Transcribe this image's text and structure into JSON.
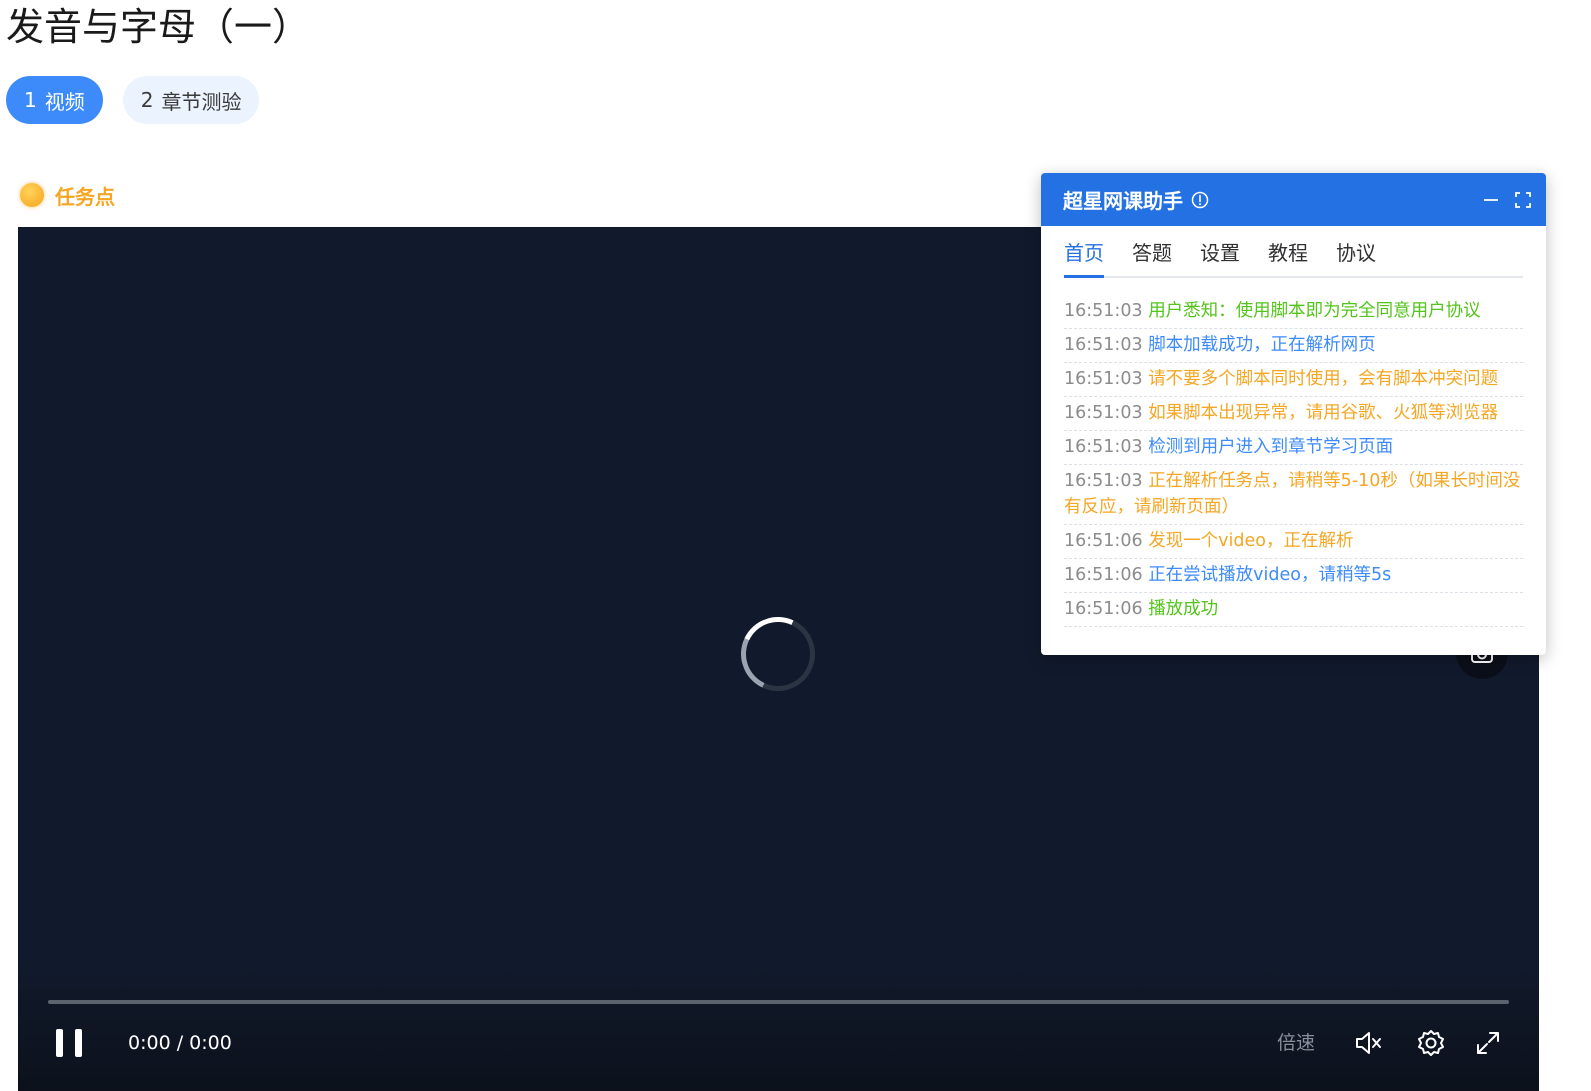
{
  "page": {
    "title": "发音与字母（一）"
  },
  "steps": [
    {
      "index": "1",
      "label": "视频",
      "active": true
    },
    {
      "index": "2",
      "label": "章节测验",
      "active": false
    }
  ],
  "task": {
    "label": "任务点"
  },
  "player": {
    "time": "0:00 / 0:00",
    "speed_label": "倍速",
    "progress": 0,
    "icons": {
      "pause": "pause-icon",
      "mute": "volume-muted-icon",
      "settings": "gear-icon",
      "fullscreen": "expand-icon",
      "screenshot": "camera-icon",
      "loading": "spinner-icon"
    }
  },
  "helper": {
    "title": "超星网课助手",
    "tabs": [
      "首页",
      "答题",
      "设置",
      "教程",
      "协议"
    ],
    "active_tab": "首页",
    "logs": [
      {
        "time": "16:51:03",
        "text": "用户悉知：使用脚本即为完全同意用户协议",
        "level": "success"
      },
      {
        "time": "16:51:03",
        "text": "脚本加载成功，正在解析网页",
        "level": "info"
      },
      {
        "time": "16:51:03",
        "text": "请不要多个脚本同时使用，会有脚本冲突问题",
        "level": "warn"
      },
      {
        "time": "16:51:03",
        "text": "如果脚本出现异常，请用谷歌、火狐等浏览器",
        "level": "warn"
      },
      {
        "time": "16:51:03",
        "text": "检测到用户进入到章节学习页面",
        "level": "info"
      },
      {
        "time": "16:51:03",
        "text": "正在解析任务点，请稍等5-10秒（如果长时间没有反应，请刷新页面）",
        "level": "warn"
      },
      {
        "time": "16:51:06",
        "text": "发现一个video，正在解析",
        "level": "warn"
      },
      {
        "time": "16:51:06",
        "text": "正在尝试播放video，请稍等5s",
        "level": "info"
      },
      {
        "time": "16:51:06",
        "text": "播放成功",
        "level": "success"
      }
    ]
  },
  "colors": {
    "accent": "#3d8bfb",
    "helper_header": "#2471e3",
    "task": "#f5a623",
    "success": "#52c41a",
    "info": "#3d8bfb",
    "warn": "#f5a623",
    "player_bg": "#111a2c"
  }
}
